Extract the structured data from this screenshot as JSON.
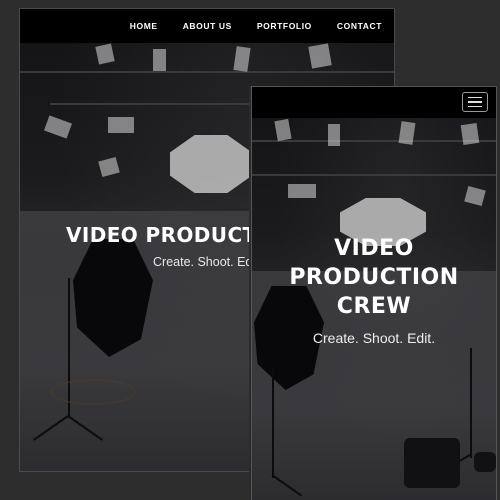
{
  "desktop": {
    "nav": {
      "items": [
        "HOME",
        "ABOUT US",
        "PORTFOLIO",
        "CONTACT"
      ]
    },
    "hero": {
      "title": "VIDEO PRODUCTI",
      "subtitle": "Create. Shoot. Edi"
    }
  },
  "mobile": {
    "nav": {
      "menu_icon": "hamburger-menu-icon"
    },
    "hero": {
      "title_lines": [
        "VIDEO",
        "PRODUCTION",
        "CREW"
      ],
      "subtitle": "Create. Shoot. Edit."
    }
  },
  "colors": {
    "page_background": "#2d2d2d",
    "nav_background": "#000000",
    "text": "#ffffff"
  }
}
